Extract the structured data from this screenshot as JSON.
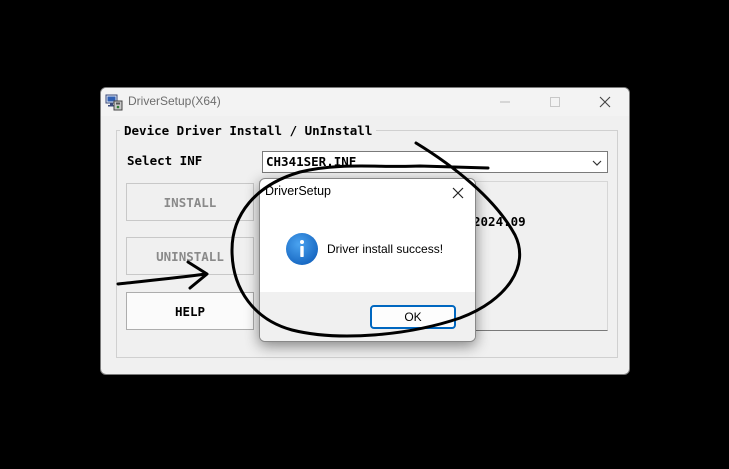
{
  "main_window": {
    "title": "DriverSetup(X64)",
    "group_title": "Device Driver Install / UnInstall",
    "select_label": "Select INF",
    "inf_value": "CH341SER.INF",
    "buttons": {
      "install": "INSTALL",
      "uninstall": "UNINSTALL",
      "help": "HELP"
    },
    "info_date": "2024.09"
  },
  "dialog": {
    "title": "DriverSetup",
    "message": "Driver install success!",
    "ok_label": "OK"
  },
  "colors": {
    "background": "#000000",
    "window": "#f0f0f0",
    "info_icon": "#1976d2",
    "ok_border": "#0067c0"
  },
  "icons": {
    "app": "driver-setup-app-icon",
    "info": "information-icon",
    "close": "close-icon",
    "minimize": "minimize-icon",
    "maximize": "maximize-icon",
    "dropdown": "chevron-down-icon"
  }
}
